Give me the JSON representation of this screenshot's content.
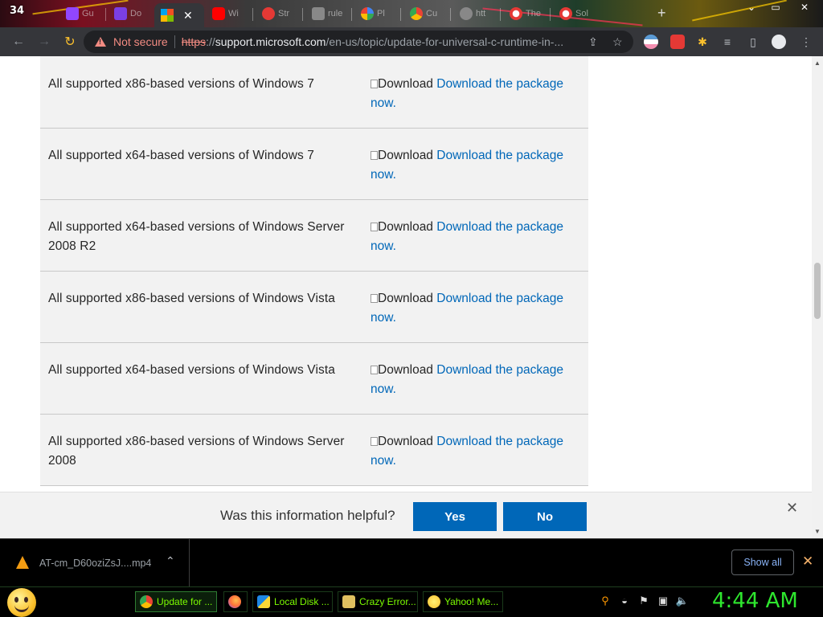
{
  "browser": {
    "tab_counter": "34",
    "tabs": [
      {
        "label": "Gu",
        "fav_color": "#9146ff"
      },
      {
        "label": "Do",
        "fav_color": "#7b3fe4"
      },
      {
        "label": "",
        "fav_color": "#f25022",
        "active": true
      },
      {
        "label": "Wi",
        "fav_color": "#ff0000"
      },
      {
        "label": "Str",
        "fav_color": "#e53935"
      },
      {
        "label": "rule",
        "fav_color": "#888888"
      },
      {
        "label": "Pl",
        "fav_color": "#4285f4"
      },
      {
        "label": "Cu",
        "fav_color": "#34a853"
      },
      {
        "label": "htt",
        "fav_color": "#888888"
      },
      {
        "label": "The",
        "fav_color": "#e53935"
      },
      {
        "label": "Sol",
        "fav_color": "#e53935"
      }
    ],
    "security_label": "Not secure",
    "url_scheme": "https",
    "url_host": "support.microsoft.com",
    "url_path": "/en-us/topic/update-for-universal-c-runtime-in-...",
    "active_tab_close": "✕"
  },
  "page": {
    "rows": [
      {
        "version": "All supported x86-based versions of Windows 7",
        "img_alt": "Download",
        "link": "Download the package now."
      },
      {
        "version": "All supported x64-based versions of Windows 7",
        "img_alt": "Download",
        "link": "Download the package now."
      },
      {
        "version": "All supported x64-based versions of Windows Server 2008 R2",
        "img_alt": "Download",
        "link": "Download the package now."
      },
      {
        "version": "All supported x86-based versions of Windows Vista",
        "img_alt": "Download",
        "link": "Download the package now."
      },
      {
        "version": "All supported x64-based versions of Windows Vista",
        "img_alt": "Download",
        "link": "Download the package now."
      },
      {
        "version": "All supported x86-based versions of Windows Server 2008",
        "img_alt": "Download",
        "link": "Download the package now."
      }
    ],
    "feedback": {
      "question": "Was this information helpful?",
      "yes": "Yes",
      "no": "No",
      "close": "✕"
    },
    "accent_color": "#0067b8"
  },
  "downloads": {
    "file_name": "AT-cm_D60oziZsJ....mp4",
    "show_all": "Show all",
    "close": "✕"
  },
  "taskbar": {
    "buttons": [
      {
        "label": "Update for ...",
        "icon_color": "#4285f4",
        "active": true
      },
      {
        "label": "",
        "icon_color": "#ff7139"
      },
      {
        "label": "Local Disk ...",
        "icon_color": "#1e88e5"
      },
      {
        "label": "Crazy Error...",
        "icon_color": "#e0c060"
      },
      {
        "label": "Yahoo! Me...",
        "icon_color": "#fbc02d"
      }
    ],
    "clock": "4:44 AM"
  }
}
